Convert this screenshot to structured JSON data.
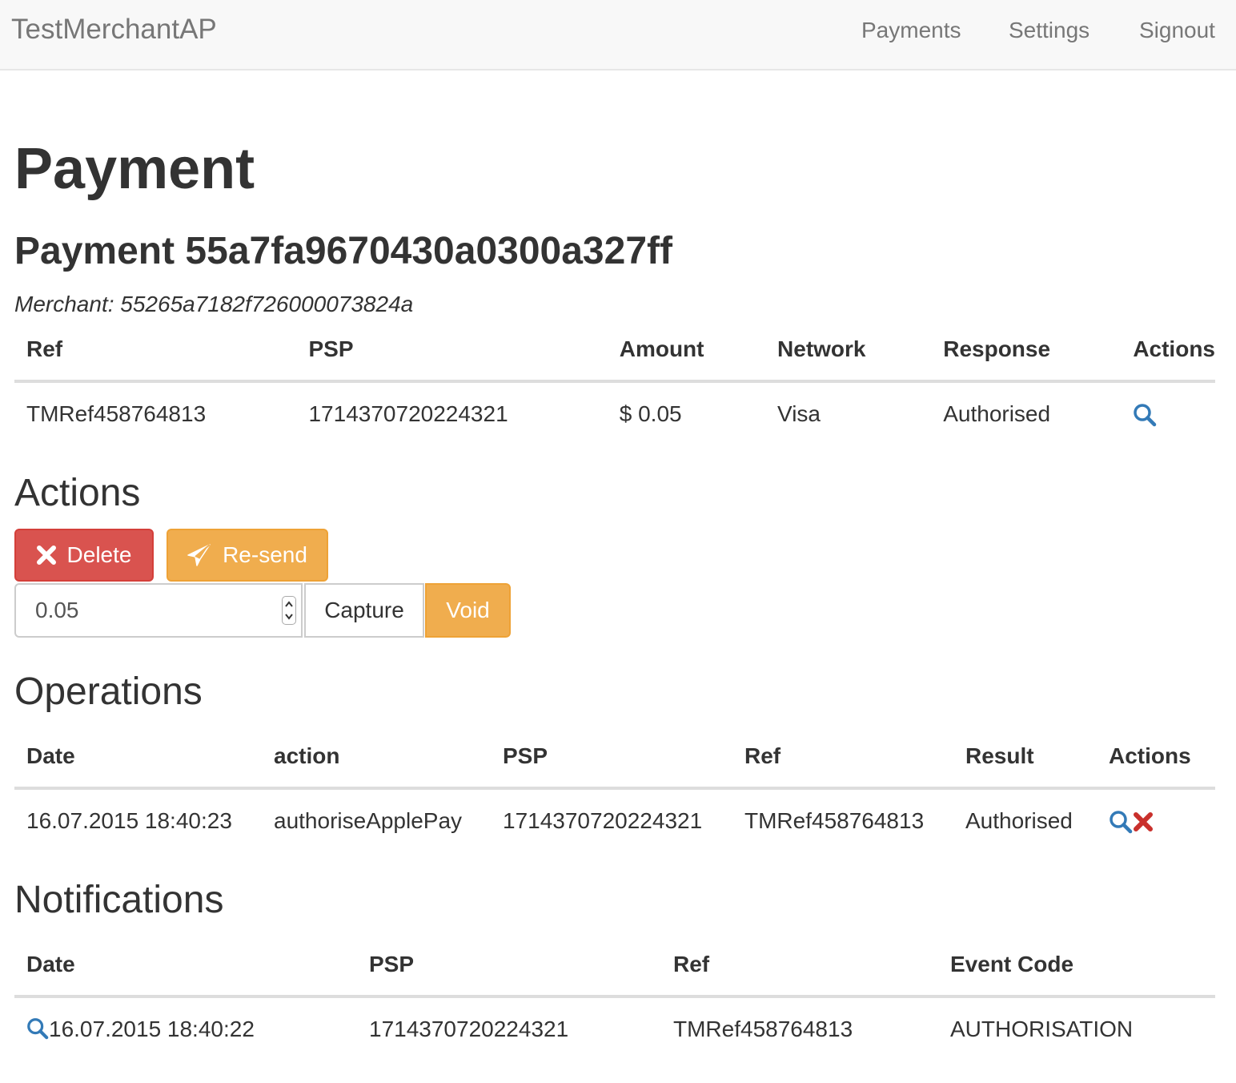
{
  "navbar": {
    "brand": "TestMerchantAP",
    "links": [
      "Payments",
      "Settings",
      "Signout"
    ]
  },
  "page_title": "Payment",
  "payment_title": "Payment 55a7fa9670430a0300a327ff",
  "merchant_line": "Merchant: 55265a7182f726000073824a",
  "payment_table": {
    "headers": [
      "Ref",
      "PSP",
      "Amount",
      "Network",
      "Response",
      "Actions"
    ],
    "rows": [
      {
        "ref": "TMRef458764813",
        "psp": "1714370720224321",
        "amount": "$ 0.05",
        "network": "Visa",
        "response": "Authorised",
        "actions": [
          "search-icon"
        ]
      }
    ]
  },
  "actions_section": {
    "title": "Actions",
    "delete_label": "Delete",
    "resend_label": "Re-send",
    "amount_value": "0.05",
    "capture_label": "Capture",
    "void_label": "Void"
  },
  "operations": {
    "title": "Operations",
    "headers": [
      "Date",
      "action",
      "PSP",
      "Ref",
      "Result",
      "Actions"
    ],
    "rows": [
      {
        "date": "16.07.2015 18:40:23",
        "action": "authoriseApplePay",
        "psp": "1714370720224321",
        "ref": "TMRef458764813",
        "result": "Authorised",
        "actions": [
          "search-icon",
          "remove-icon"
        ]
      }
    ]
  },
  "notifications": {
    "title": "Notifications",
    "headers": [
      "Date",
      "PSP",
      "Ref",
      "Event Code"
    ],
    "rows": [
      {
        "date": "16.07.2015 18:40:22",
        "psp": "1714370720224321",
        "ref": "TMRef458764813",
        "event_code": "AUTHORISATION"
      }
    ]
  },
  "colors": {
    "link": "#337ab7",
    "danger": "#d9534f",
    "warning": "#f0ad4e",
    "remove_icon": "#c9302c",
    "text": "#333333",
    "muted": "#777777"
  }
}
